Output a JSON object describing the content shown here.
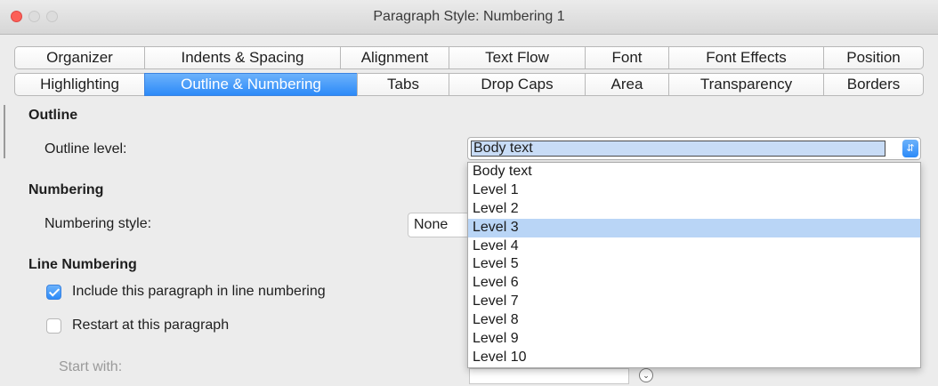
{
  "window": {
    "title": "Paragraph Style: Numbering 1"
  },
  "tabs_row1": [
    "Organizer",
    "Indents & Spacing",
    "Alignment",
    "Text Flow",
    "Font",
    "Font Effects",
    "Position"
  ],
  "tabs_row2": [
    "Highlighting",
    "Outline & Numbering",
    "Tabs",
    "Drop Caps",
    "Area",
    "Transparency",
    "Borders"
  ],
  "active_tab": "Outline & Numbering",
  "outline": {
    "heading": "Outline",
    "level_label": "Outline level:",
    "level_value": "Body text",
    "options": [
      "Body text",
      "Level 1",
      "Level 2",
      "Level 3",
      "Level 4",
      "Level 5",
      "Level 6",
      "Level 7",
      "Level 8",
      "Level 9",
      "Level 10"
    ],
    "highlighted_option": "Level 3"
  },
  "numbering": {
    "heading": "Numbering",
    "style_label": "Numbering style:",
    "style_value": "None"
  },
  "line_numbering": {
    "heading": "Line Numbering",
    "include_label": "Include this paragraph in line numbering",
    "include_checked": true,
    "restart_label": "Restart at this paragraph",
    "restart_checked": false,
    "start_with_label": "Start with:"
  },
  "colors": {
    "accent": "#2c8af8",
    "highlight": "#b9d5f6"
  }
}
